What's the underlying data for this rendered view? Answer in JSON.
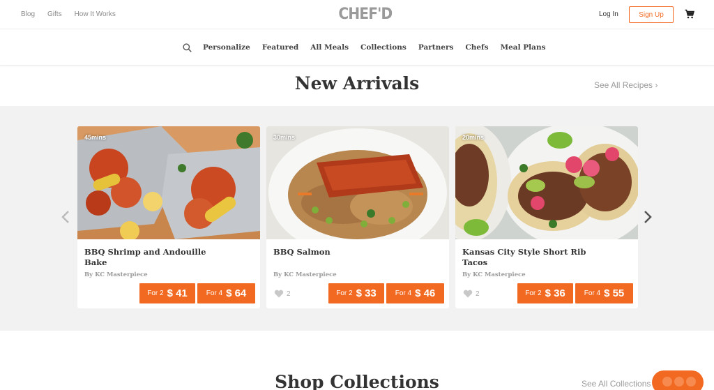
{
  "header": {
    "links": [
      "Blog",
      "Gifts",
      "How It Works"
    ],
    "logo": "CHEF'D",
    "login": "Log In",
    "signup": "Sign Up",
    "cart_icon": "cart-icon"
  },
  "nav": {
    "search_icon": "search-icon",
    "items": [
      "Personalize",
      "Featured",
      "All Meals",
      "Collections",
      "Partners",
      "Chefs",
      "Meal Plans"
    ]
  },
  "new_arrivals": {
    "title": "New Arrivals",
    "see_all": "See All Recipes ›",
    "cards": [
      {
        "time": "45mins",
        "name": "BBQ Shrimp and Andouille Bake",
        "by": "By KC Masterpiece",
        "likes": "",
        "price_for2_label": "For 2",
        "price_for2": "$ 41",
        "price_for4_label": "For 4",
        "price_for4": "$ 64"
      },
      {
        "time": "30mins",
        "name": "BBQ Salmon",
        "by": "By KC Masterpiece",
        "likes": "2",
        "price_for2_label": "For 2",
        "price_for2": "$ 33",
        "price_for4_label": "For 4",
        "price_for4": "$ 46"
      },
      {
        "time": "20mins",
        "name": "Kansas City Style Short Rib Tacos",
        "by": "By KC Masterpiece",
        "likes": "2",
        "price_for2_label": "For 2",
        "price_for2": "$ 36",
        "price_for4_label": "For 4",
        "price_for4": "$ 55"
      }
    ]
  },
  "shop_collections": {
    "title": "Shop Collections",
    "see_all": "See All Collections ›"
  },
  "colors": {
    "accent": "#f26a21",
    "band": "#f2f2f2",
    "muted": "#9a9a9a"
  }
}
